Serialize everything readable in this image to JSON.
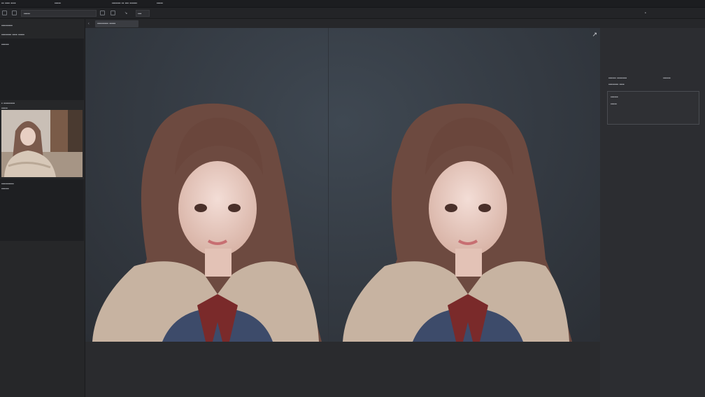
{
  "menubar": {
    "items": [
      "▪▪ ▪▪▪▪ ▪▪▪▪",
      "▪▪▪▪▪",
      "▪▪▪▪▪▪▪ ▪▪ ▪▪▪ ▪▪▪▪▪▪",
      "▪▪▪▪▪"
    ]
  },
  "toolbar": {
    "field_text": "▪▪▪▪▪",
    "zoom_text": "▪▪▪"
  },
  "tabbar": {
    "tab_label": "▪▪▪▪▪▪▪▪▪ ▪▪▪▪▪"
  },
  "left_panel": {
    "section1_title": "▪▪▪▪▪▪▪▪▪",
    "section1_sub": "▪▪▪▪▪▪▪▪ ▪▪▪▪ ▪▪▪▪▪",
    "section1_item": "▪▪▪▪▪▪",
    "section2_title": "▪ ▪▪▪▪▪▪▪▪▪",
    "section2_sub": "▪▪▪▪▪",
    "thumb_caption": "▪▪▪▪▪▪▪▪▪▪",
    "thumb_caption2": "▪▪▪▪▪▪"
  },
  "right_panel": {
    "title": "▪▪▪▪▪▪ ▪▪▪▪▪▪▪▪",
    "title_value": "▪▪▪▪▪▪",
    "subtitle": "▪▪▪▪▪▪▪▪ ▪▪▪▪",
    "box_line1": "▪▪▪▪▪▪",
    "box_line2": "▪▪▪▪▪"
  },
  "canvas": {
    "expand_icon": "arrow-expand-icon"
  },
  "colors": {
    "bg": "#2a2b2e",
    "panel": "#262729",
    "canvas": "#343a42",
    "accent": "#5a6b7c"
  }
}
